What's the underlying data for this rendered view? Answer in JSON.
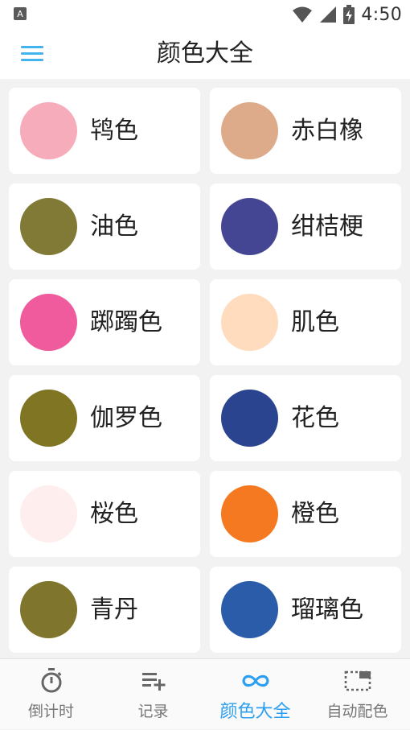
{
  "status_bar": {
    "time": "4:50",
    "left_icon": "a-notification-icon",
    "right_icons": [
      "wifi-icon",
      "cell-signal-icon",
      "battery-charging-icon"
    ]
  },
  "header": {
    "title": "颜色大全",
    "menu_icon": "hamburger-menu-icon"
  },
  "colors": [
    {
      "name": "鸨色",
      "hex": "#f7acbc"
    },
    {
      "name": "赤白橡",
      "hex": "#deab8a"
    },
    {
      "name": "油色",
      "hex": "#817936"
    },
    {
      "name": "绀桔梗",
      "hex": "#444693"
    },
    {
      "name": "踯躅色",
      "hex": "#ef5b9c"
    },
    {
      "name": "肌色",
      "hex": "#fedcbd"
    },
    {
      "name": "伽罗色",
      "hex": "#7f7522"
    },
    {
      "name": "花色",
      "hex": "#2b4490"
    },
    {
      "name": "桜色",
      "hex": "#feeeed"
    },
    {
      "name": "橙色",
      "hex": "#f47920"
    },
    {
      "name": "青丹",
      "hex": "#80752c"
    },
    {
      "name": "瑠璃色",
      "hex": "#2a5caa"
    }
  ],
  "bottom_nav": {
    "items": [
      {
        "label": "倒计时",
        "icon": "stopwatch-icon",
        "active": false
      },
      {
        "label": "记录",
        "icon": "playlist-add-icon",
        "active": false
      },
      {
        "label": "颜色大全",
        "icon": "infinity-icon",
        "active": true
      },
      {
        "label": "自动配色",
        "icon": "dashed-frame-icon",
        "active": false
      }
    ]
  },
  "theme": {
    "accent": "#2c9ff0",
    "menu_icon_color": "#45b3f0",
    "nav_icon_color": "#666666"
  }
}
